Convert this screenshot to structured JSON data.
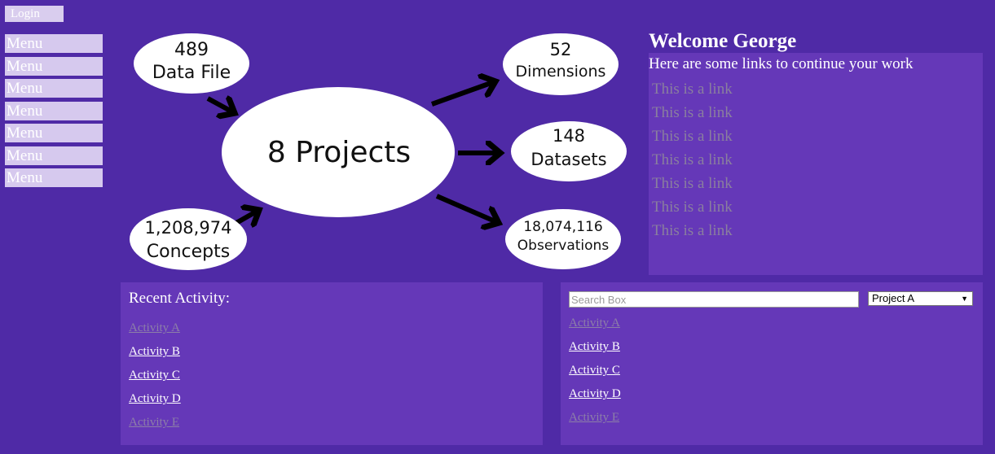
{
  "header": {
    "login_label": "Login"
  },
  "sidebar": {
    "items": [
      {
        "label": "Menu"
      },
      {
        "label": "Menu"
      },
      {
        "label": "Menu"
      },
      {
        "label": "Menu"
      },
      {
        "label": "Menu"
      },
      {
        "label": "Menu"
      },
      {
        "label": "Menu"
      }
    ]
  },
  "diagram": {
    "center": "8 Projects",
    "data_file": {
      "value": "489",
      "label": "Data File"
    },
    "concepts": {
      "value": "1,208,974",
      "label": "Concepts"
    },
    "dimensions": {
      "value": "52",
      "label": "Dimensions"
    },
    "datasets": {
      "value": "148",
      "label": "Datasets"
    },
    "observations": {
      "value": "18,074,116",
      "label": "Observations"
    }
  },
  "welcome": {
    "title": "Welcome George",
    "intro": "Here are some links to continue your work",
    "links": [
      "This is a link",
      "This is a link",
      "This is a link",
      "This is a link",
      "This is a link",
      "This is a link",
      "This is a link"
    ]
  },
  "recent_activity": {
    "title": "Recent Activity:",
    "items": [
      "Activity A",
      "Activity B",
      "Activity C",
      "Activity D",
      "Activity E"
    ]
  },
  "search": {
    "placeholder": "Search Box",
    "selected_project": "Project A",
    "results": [
      "Activity A",
      "Activity B",
      "Activity C",
      "Activity D",
      "Activity E"
    ]
  },
  "colors": {
    "background": "#4f2aa6",
    "panel": "#6538b8",
    "menu": "#d6c9ee",
    "visited_link": "#8d7fa8"
  }
}
